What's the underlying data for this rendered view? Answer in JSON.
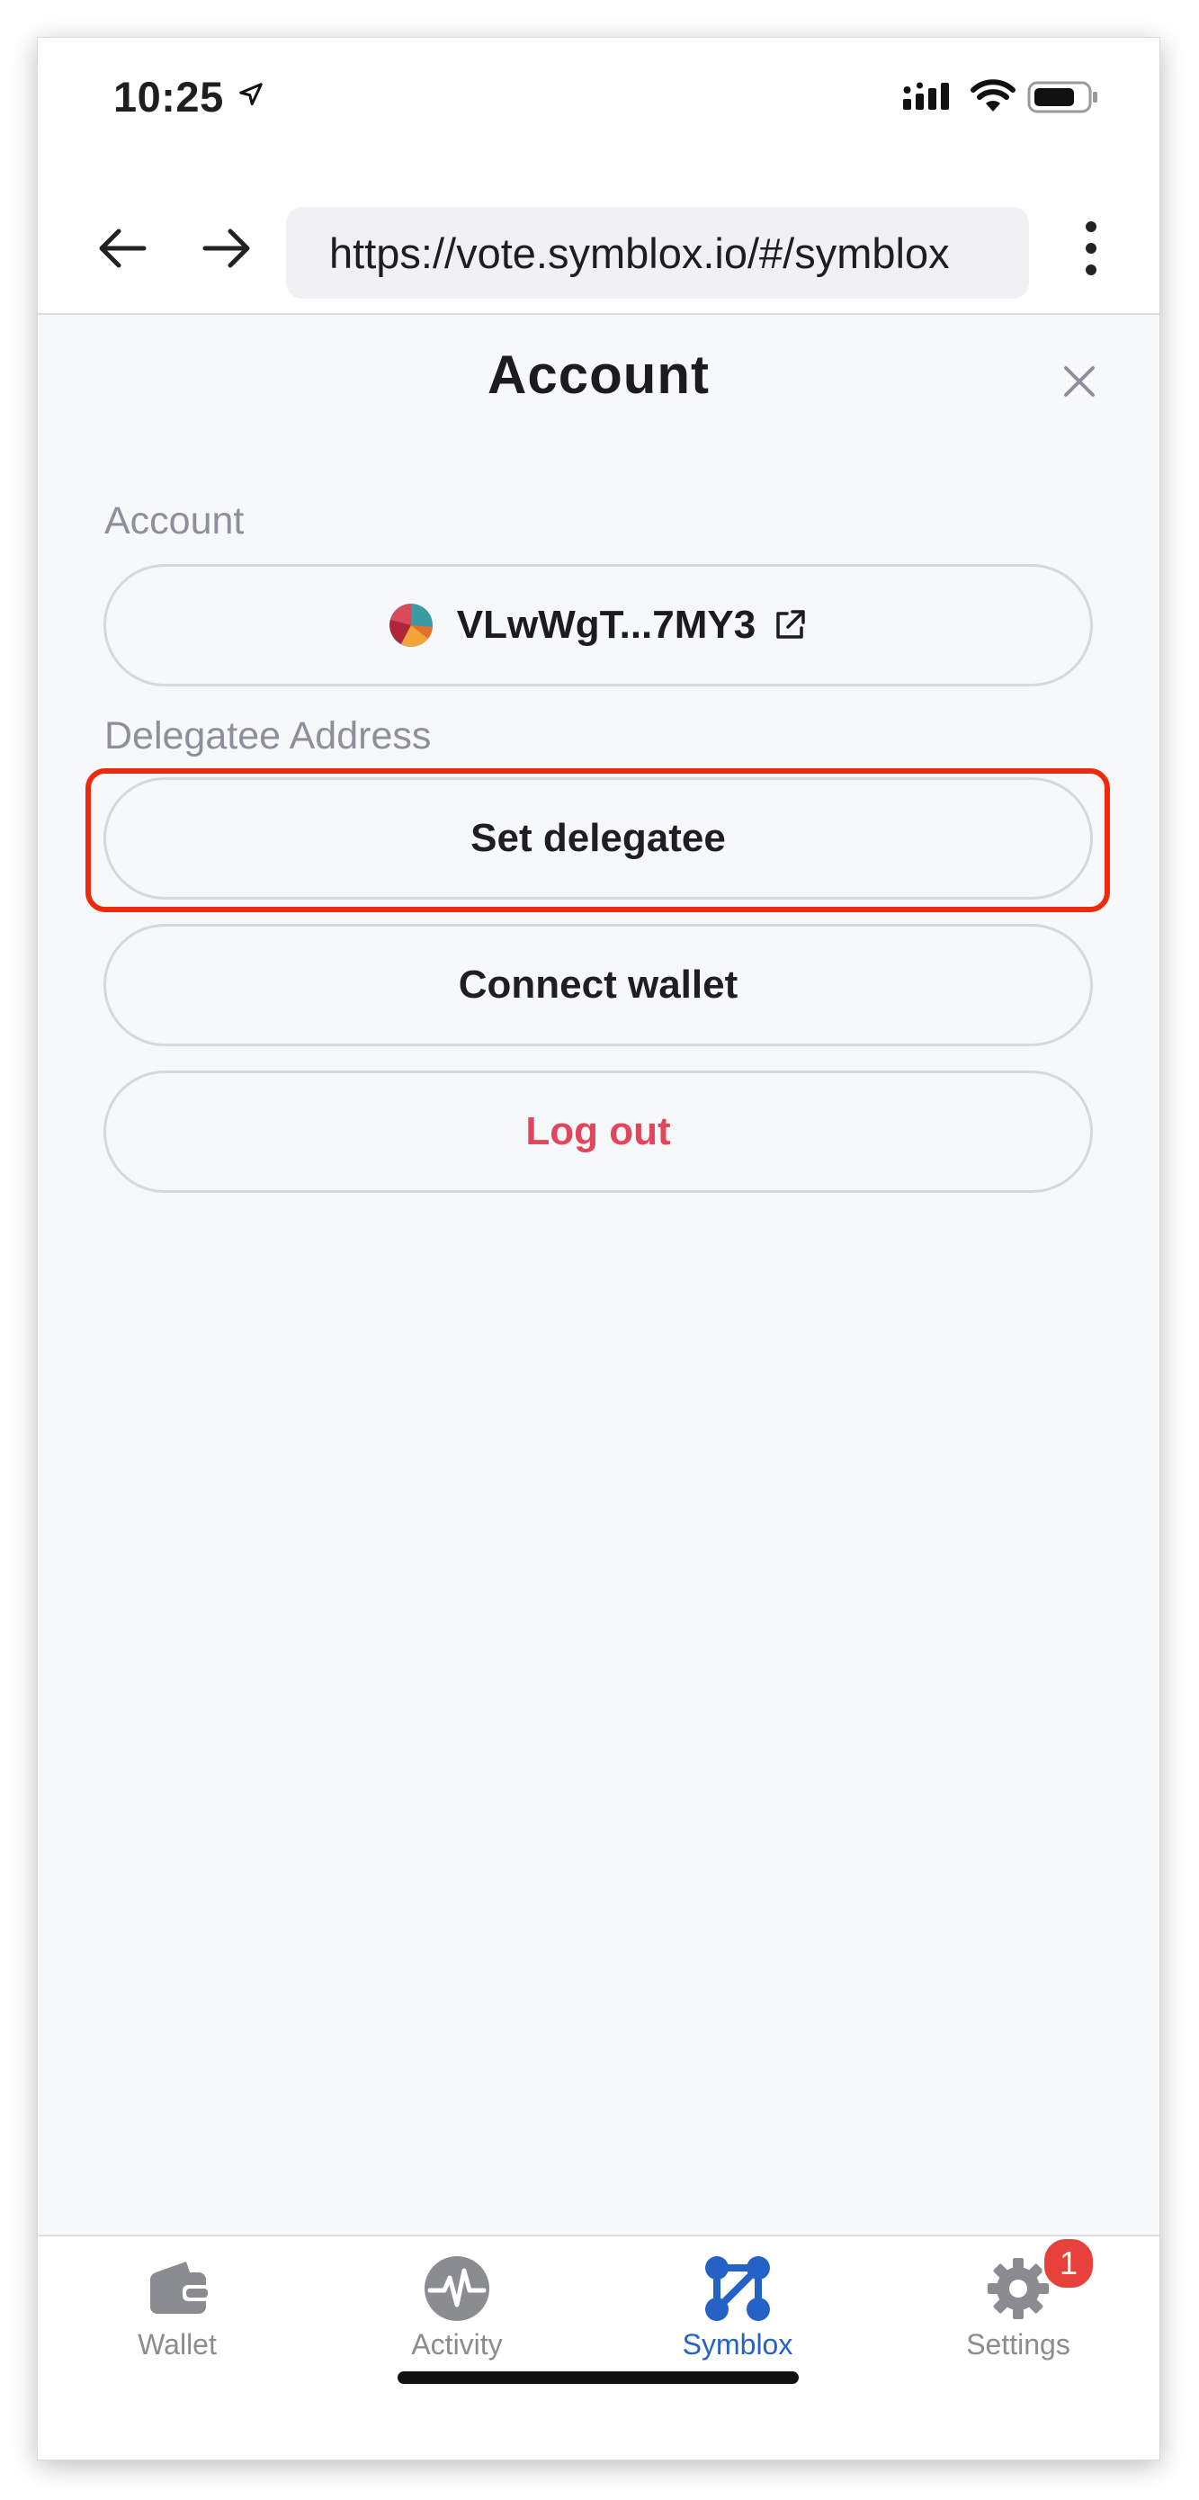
{
  "status_bar": {
    "time": "10:25"
  },
  "browser": {
    "url": "https://vote.symblox.io/#/symblox"
  },
  "modal": {
    "title": "Account",
    "account_label": "Account",
    "account_address": "VLwWgT...7MY3",
    "delegatee_label": "Delegatee Address",
    "set_delegatee": "Set delegatee",
    "connect_wallet": "Connect wallet",
    "log_out": "Log out"
  },
  "tab_bar": {
    "tabs": [
      {
        "label": "Wallet",
        "icon": "wallet-icon"
      },
      {
        "label": "Activity",
        "icon": "activity-icon"
      },
      {
        "label": "Symblox",
        "icon": "symblox-icon",
        "active": true
      },
      {
        "label": "Settings",
        "icon": "gear-icon",
        "badge": "1"
      }
    ]
  },
  "colors": {
    "accent": "#2562c8",
    "danger": "#e3465a",
    "highlight": "#ee2a0e",
    "badge": "#e8403b"
  }
}
